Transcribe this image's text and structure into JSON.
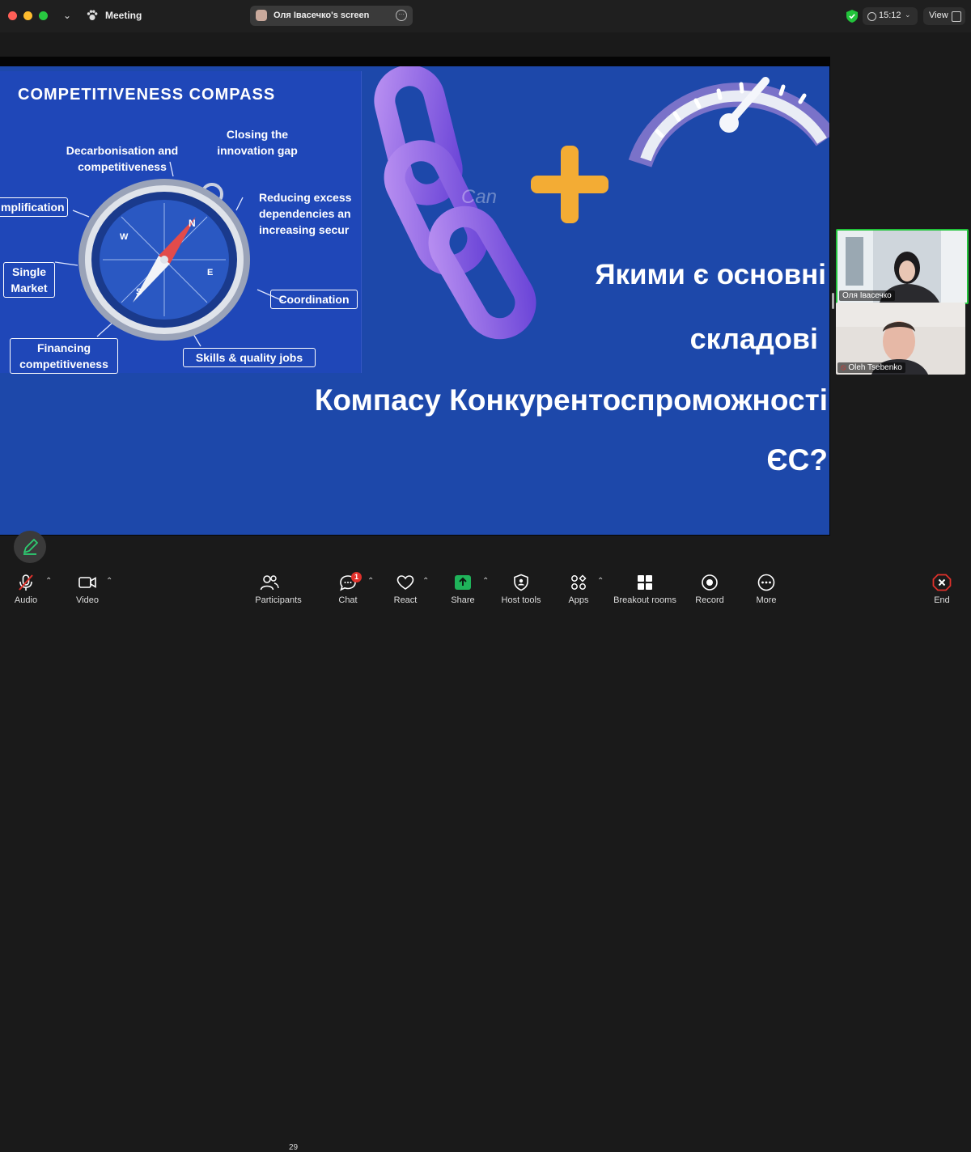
{
  "window": {
    "app_title": "Meeting",
    "screen_share_label": "Оля Івасечко's screen",
    "timer": "15:12",
    "view_label": "View"
  },
  "slide": {
    "compass_title": "COMPETITIVENESS COMPASS",
    "items": {
      "decarbonisation": "Decarbonisation and competitiveness",
      "innovation": "Closing the innovation gap",
      "dependencies": "Reducing excess dependencies an increasing secur",
      "simplification": "mplification",
      "single_market": "Single Market",
      "coordination": "Coordination",
      "financing": "Financing competitiveness",
      "skills": "Skills & quality jobs"
    },
    "question_lines": [
      "Якими є основні",
      "складові",
      "Компасу Конкурентоспроможності",
      "ЄС?"
    ],
    "watermark": "Can"
  },
  "participants": [
    {
      "name": "Оля Івасечко",
      "active_speaker": true
    },
    {
      "name": "Oleh Tsebenko",
      "muted": true
    }
  ],
  "toolbar": {
    "audio": "Audio",
    "video": "Video",
    "participants": "Participants",
    "participants_count": "29",
    "chat": "Chat",
    "chat_badge": "1",
    "react": "React",
    "share": "Share",
    "host_tools": "Host tools",
    "apps": "Apps",
    "breakout": "Breakout rooms",
    "record": "Record",
    "more": "More",
    "end": "End"
  },
  "colors": {
    "slide_bg": "#1d48aa",
    "active_speaker": "#22c33b",
    "share_green": "#1fb35a",
    "end_red": "#e0312b"
  }
}
